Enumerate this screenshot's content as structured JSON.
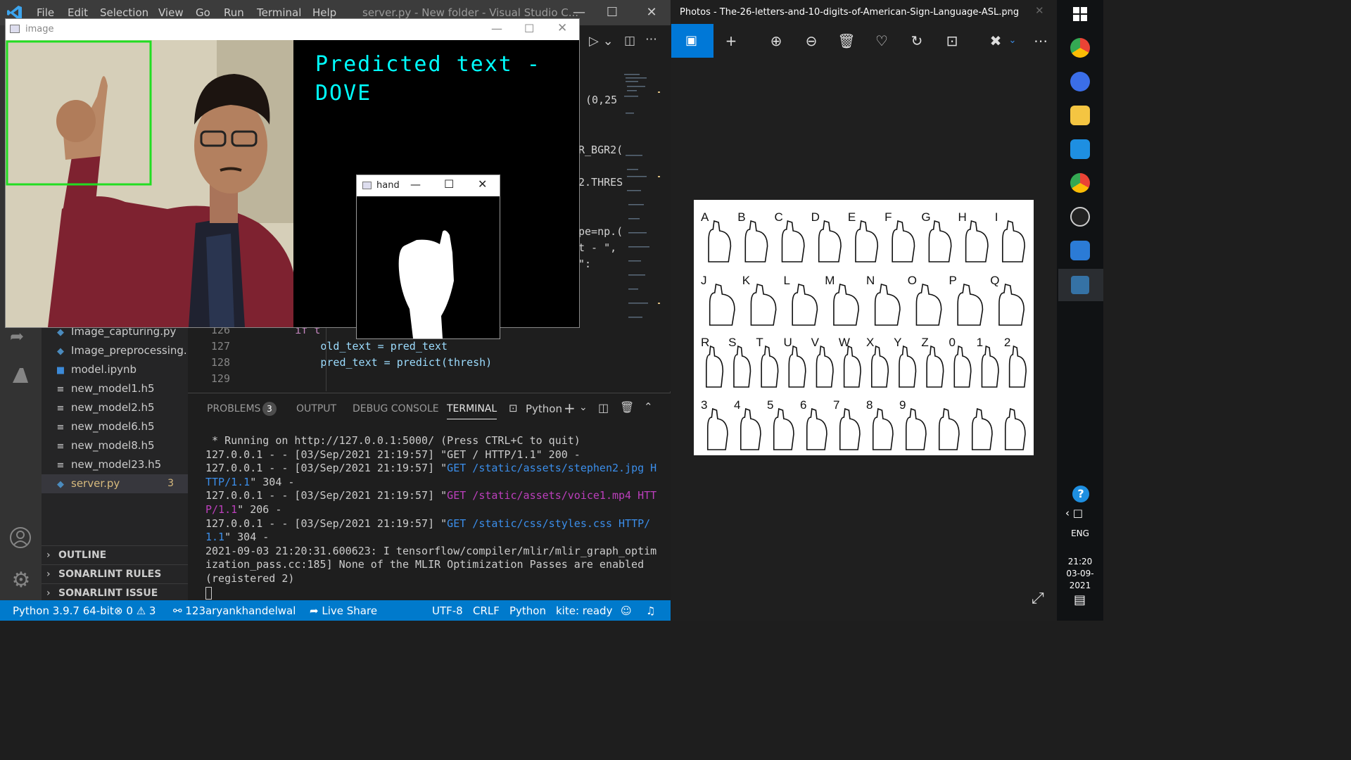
{
  "vscode": {
    "menu": [
      "File",
      "Edit",
      "Selection",
      "View",
      "Go",
      "Run",
      "Terminal",
      "Help"
    ],
    "title": "server.py - New folder - Visual Studio C...",
    "files": [
      {
        "name": "Image_capturing.py",
        "icon": "python-file-icon"
      },
      {
        "name": "Image_preprocessing....",
        "icon": "python-file-icon"
      },
      {
        "name": "model.ipynb",
        "icon": "notebook-file-icon"
      },
      {
        "name": "new_model1.h5",
        "icon": "text-file-icon"
      },
      {
        "name": "new_model2.h5",
        "icon": "text-file-icon"
      },
      {
        "name": "new_model6.h5",
        "icon": "text-file-icon"
      },
      {
        "name": "new_model8.h5",
        "icon": "text-file-icon"
      },
      {
        "name": "new_model23.h5",
        "icon": "text-file-icon"
      },
      {
        "name": "server.py",
        "icon": "python-file-icon",
        "problems": "3"
      }
    ],
    "sections": [
      "OUTLINE",
      "SONARLINT RULES",
      "SONARLINT ISSUE LOCATI..."
    ],
    "code_fragments": [
      "(0,25",
      "R_BGR2(",
      "2.THRES",
      "pe=np.(",
      "t - \",",
      "\":"
    ],
    "code_lines": [
      {
        "num": "126",
        "text": "        if t"
      },
      {
        "num": "127",
        "text": "            old_text = pred_text"
      },
      {
        "num": "128",
        "text": "            pred_text = predict(thresh)"
      },
      {
        "num": "129",
        "text": ""
      }
    ],
    "panel_tabs": [
      "PROBLEMS",
      "OUTPUT",
      "DEBUG CONSOLE",
      "TERMINAL"
    ],
    "problems_count": "3",
    "terminal_shell": "Python",
    "terminal_lines": [
      [
        {
          "t": " * Running on http://127.0.0.1:5000/ (Press CTRL+C to quit)"
        }
      ],
      [
        {
          "t": "127.0.0.1 - - [03/Sep/2021 21:19:57] \"GET / HTTP/1.1\" 200 -"
        }
      ],
      [
        {
          "t": "127.0.0.1 - - [03/Sep/2021 21:19:57] \""
        },
        {
          "t": "GET /static/assets/stephen2.jpg HTTP/1.1",
          "c": "cy"
        },
        {
          "t": "\" 304 -"
        }
      ],
      [
        {
          "t": "127.0.0.1 - - [03/Sep/2021 21:19:57] \""
        },
        {
          "t": "GET /static/assets/voice1.mp4 HTTP/1.1",
          "c": "mg"
        },
        {
          "t": "\" 206 -"
        }
      ],
      [
        {
          "t": "127.0.0.1 - - [03/Sep/2021 21:19:57] \""
        },
        {
          "t": "GET /static/css/styles.css HTTP/1.1",
          "c": "cy"
        },
        {
          "t": "\" 304 -"
        }
      ],
      [
        {
          "t": "2021-09-03 21:20:31.600623: I tensorflow/compiler/mlir/mlir_graph_optimization_pass.cc:185] None of the MLIR Optimization Passes are enabled (registered 2)"
        }
      ]
    ],
    "status": {
      "interpreter": "Python 3.9.7 64-bit",
      "errors": "0",
      "warnings": "3",
      "account": "123aryankhandelwal",
      "live_share": "Live Share",
      "encoding": "UTF-8",
      "eol": "CRLF",
      "language": "Python",
      "kite": "kite: ready"
    }
  },
  "image_window": {
    "title": "image",
    "predicted_line1": "Predicted text -",
    "predicted_line2": "DOVE"
  },
  "hand_window": {
    "title": "hand"
  },
  "photos": {
    "title": "Photos - The-26-letters-and-10-digits-of-American-Sign-Language-ASL.png",
    "letters": [
      "A",
      "B",
      "C",
      "D",
      "E",
      "F",
      "G",
      "H",
      "I",
      "J",
      "K",
      "L",
      "M",
      "N",
      "O",
      "P",
      "Q",
      "R",
      "S",
      "T",
      "U",
      "V",
      "W",
      "X",
      "Y",
      "Z",
      "0",
      "1",
      "2",
      "3",
      "4",
      "5",
      "6",
      "7",
      "8",
      "9"
    ]
  },
  "taskbar": {
    "language": "ENG",
    "time": "21:20",
    "date": "03-09-2021"
  },
  "colors": {
    "statusbar": "#007acc",
    "predicted_text": "#00ffff",
    "roi_box": "#22dd22",
    "photos_accent": "#0078d7"
  }
}
